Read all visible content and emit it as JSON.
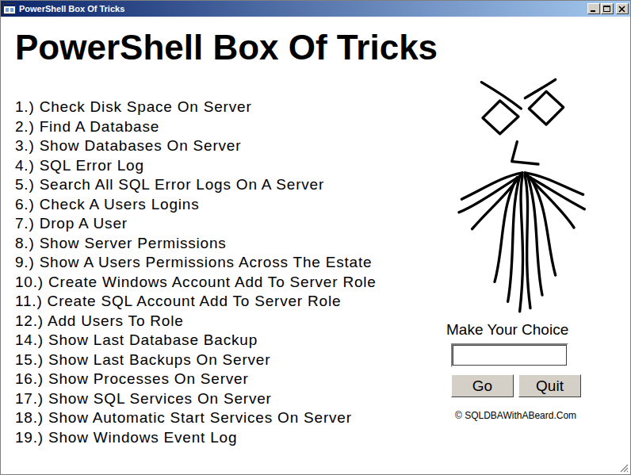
{
  "window": {
    "title": "PowerShell Box Of Tricks"
  },
  "heading": "PowerShell Box Of Tricks",
  "menu": [
    "1.) Check Disk Space On Server",
    "2.) Find A Database",
    "3.) Show Databases On Server",
    "4.) SQL Error Log",
    "5.) Search All SQL Error Logs On A Server",
    "6.) Check A Users Logins",
    "7.) Drop A User",
    "8.) Show Server Permissions",
    "9.) Show A Users Permissions Across The Estate",
    "10.) Create Windows Account Add To Server Role",
    "11.) Create SQL Account Add To Server Role",
    "12.) Add Users To Role",
    "14.) Show Last Database Backup",
    "15.) Show Last Backups On Server",
    "16.) Show Processes On Server",
    "17.) Show SQL Services On Server",
    "18.) Show Automatic Start Services On Server",
    "19.) Show Windows Event Log"
  ],
  "choice": {
    "label": "Make Your Choice",
    "value": ""
  },
  "buttons": [
    "Go",
    "Quit"
  ],
  "copyright": "© SQLDBAWithABeard.Com"
}
